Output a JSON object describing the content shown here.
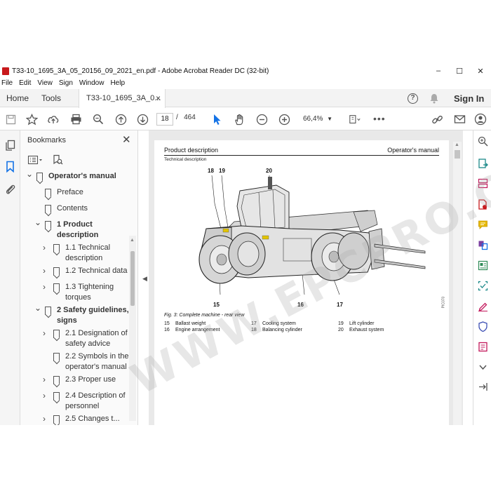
{
  "window": {
    "title": "T33-10_1695_3A_05_20156_09_2021_en.pdf - Adobe Acrobat Reader DC (32-bit)",
    "minimize": "–",
    "maximize": "☐",
    "close": "✕"
  },
  "menu": [
    "File",
    "Edit",
    "View",
    "Sign",
    "Window",
    "Help"
  ],
  "tabs": {
    "home": "Home",
    "tools": "Tools",
    "document": "T33-10_1695_3A_0...",
    "document_close": "×",
    "sign_in": "Sign In"
  },
  "toolbar": {
    "page_current": "18",
    "page_separator": "/",
    "page_total": "464",
    "zoom": "66,4%",
    "more": "•••"
  },
  "bookmarks": {
    "title": "Bookmarks",
    "close": "✕",
    "items": [
      {
        "label": "Operator's manual",
        "bold": true,
        "chevron": "open"
      },
      {
        "label": "Preface",
        "bold": false,
        "chevron": "none"
      },
      {
        "label": "Contents",
        "bold": false,
        "chevron": "none"
      },
      {
        "label": "1 Product",
        "label2": "description",
        "bold": true,
        "chevron": "open"
      },
      {
        "label": "1.1 Technical",
        "label2": "description",
        "bold": false,
        "chevron": "closed"
      },
      {
        "label": "1.2 Technical data",
        "bold": false,
        "chevron": "closed"
      },
      {
        "label": "1.3 Tightening",
        "label2": "torques",
        "bold": false,
        "chevron": "closed"
      },
      {
        "label": "2 Safety guidelines,",
        "label2": "signs",
        "bold": true,
        "chevron": "open"
      },
      {
        "label": "2.1 Designation of",
        "label2": "safety advice",
        "bold": false,
        "chevron": "closed"
      },
      {
        "label": "2.2 Symbols in the",
        "label2": "operator's manual",
        "bold": false,
        "chevron": "none"
      },
      {
        "label": "2.3 Proper use",
        "bold": false,
        "chevron": "closed"
      },
      {
        "label": "2.4 Description of",
        "label2": "personnel",
        "bold": false,
        "chevron": "closed"
      },
      {
        "label": "2.5 Changes t...",
        "bold": false,
        "chevron": "closed"
      }
    ]
  },
  "page": {
    "header_left": "Product description",
    "header_right": "Operator's manual",
    "subheader": "Technical description",
    "callouts": [
      "18",
      "19",
      "20",
      "15",
      "16",
      "17"
    ],
    "figure_ref": "PIC070",
    "caption": "Fig. 3: Complete machine - rear view",
    "legend": [
      [
        {
          "n": "15",
          "t": "Ballast weight"
        },
        {
          "n": "17",
          "t": "Cooling system"
        },
        {
          "n": "19",
          "t": "Lift cylinder"
        }
      ],
      [
        {
          "n": "16",
          "t": "Engine arrangement"
        },
        {
          "n": "18",
          "t": "Balancing cylinder"
        },
        {
          "n": "20",
          "t": "Exhaust system"
        }
      ]
    ]
  },
  "watermark": "WWW.EPCPRO.COM",
  "colors": {
    "acrobat_red": "#c8191c",
    "selection_blue": "#1473e6",
    "tool_purple": "#7b3fa0",
    "tool_green": "#2e8b57",
    "tool_orange": "#e68619"
  }
}
